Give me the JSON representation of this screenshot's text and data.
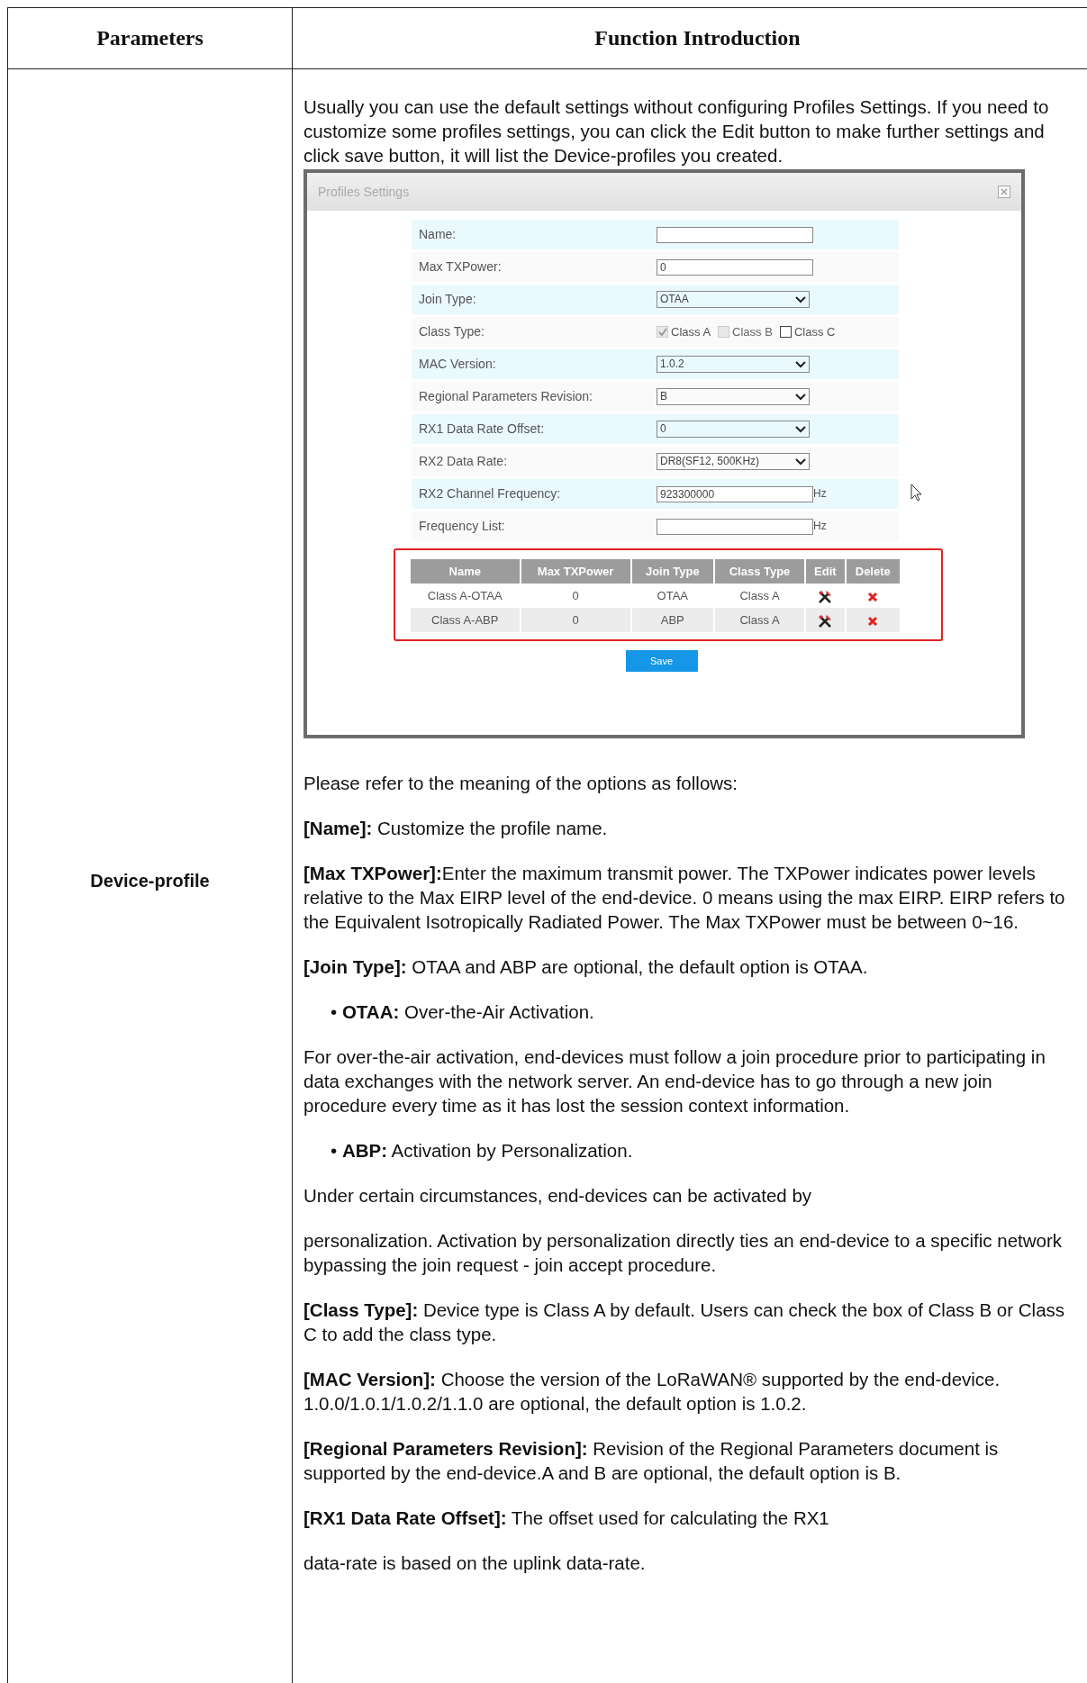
{
  "header": {
    "col_1": "Parameters",
    "col_2": "Function Introduction"
  },
  "row": {
    "parameter": "Device-profile",
    "intro": "Usually you can use the default settings without configuring Profiles Settings. If you need to customize some profiles settings, you can click the Edit button to make further settings and click save button, it will list the Device-profiles you created.",
    "dialog": {
      "title": "Profiles Settings",
      "rows": [
        {
          "label": "Name:",
          "kind": "text"
        },
        {
          "label": "Max TXPower:",
          "kind": "text",
          "value": "0"
        },
        {
          "label": "Join Type:",
          "kind": "select",
          "value": "OTAA"
        },
        {
          "label": "Class Type:",
          "kind": "checks",
          "options": [
            {
              "label": "Class A",
              "checked": true,
              "disabled": true
            },
            {
              "label": "Class B",
              "checked": false,
              "disabled": true
            },
            {
              "label": "Class C",
              "checked": false,
              "disabled": false
            }
          ]
        },
        {
          "label": "MAC Version:",
          "kind": "select",
          "value": "1.0.2"
        },
        {
          "label": "Regional Parameters Revision:",
          "kind": "select",
          "value": "B"
        },
        {
          "label": "RX1 Data Rate Offset:",
          "kind": "select",
          "value": "0"
        },
        {
          "label": "RX2 Data Rate:",
          "kind": "select",
          "value": "DR8(SF12, 500KHz)"
        },
        {
          "label": "RX2 Channel Frequency:",
          "kind": "text",
          "value": "923300000",
          "unit": "Hz"
        },
        {
          "label": "Frequency List:",
          "kind": "text",
          "unit": "Hz"
        }
      ],
      "table": {
        "columns": [
          "Name",
          "Max TXPower",
          "Join Type",
          "Class Type",
          "Edit",
          "Delete"
        ],
        "rows": [
          [
            "Class A-OTAA",
            "0",
            "OTAA",
            "Class A"
          ],
          [
            "Class A-ABP",
            "0",
            "ABP",
            "Class A"
          ]
        ]
      },
      "save": "Save"
    },
    "paragraphs": [
      {
        "kind": "para",
        "text": "Please refer to the meaning of the options as follows:"
      },
      {
        "kind": "para",
        "text": "**[Name]:** Customize the profile name."
      },
      {
        "kind": "para",
        "text": "**[Max TXPower]:**Enter the maximum transmit power. The TXPower indicates power levels relative to the Max EIRP level of the end-device. 0 means using the max EIRP. EIRP refers to the Equivalent Isotropically Radiated Power. The Max TXPower must be between 0~16."
      },
      {
        "kind": "para",
        "text": "**[Join Type]:** OTAA and ABP are optional, the default option is OTAA."
      },
      {
        "kind": "bullet",
        "text": "• **OTAA:** Over-the-Air Activation."
      },
      {
        "kind": "para",
        "text": "For over-the-air activation, end-devices must follow a join procedure prior to participating in data exchanges with the network server. An end-device has to go through a new join procedure every time as it has lost the session context information."
      },
      {
        "kind": "bullet",
        "text": "• **ABP:** Activation by Personalization."
      },
      {
        "kind": "para",
        "text": "Under certain circumstances, end-devices can be activated by"
      },
      {
        "kind": "para",
        "text": "personalization. Activation by personalization directly ties an end-device to a specific network bypassing the join request - join accept procedure."
      },
      {
        "kind": "para",
        "text": "**[Class Type]:** Device type is Class A by default. Users can check the box of Class B or Class C to add the class type."
      },
      {
        "kind": "para",
        "text": "**[MAC Version]:** Choose the version of the LoRaWAN® supported by the end-device. 1.0.0/1.0.1/1.0.2/1.1.0 are optional, the default option is 1.0.2."
      },
      {
        "kind": "para",
        "text": "**[Regional Parameters Revision]:** Revision of the Regional Parameters document is supported by the end-device.A and B are optional, the default option is B."
      },
      {
        "kind": "para",
        "text": "**[RX1 Data Rate Offset]:** The offset used for calculating the RX1"
      },
      {
        "kind": "para",
        "text": "data-rate is based on the uplink data-rate."
      }
    ]
  }
}
